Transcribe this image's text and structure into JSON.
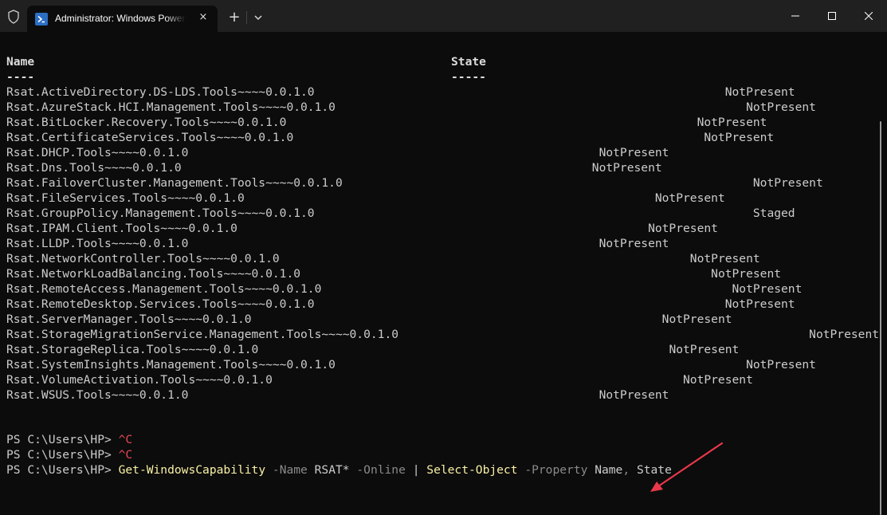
{
  "window": {
    "tab_title": "Administrator: Windows PowerShell",
    "tab_close": "×",
    "new_tab": "+"
  },
  "table": {
    "headers": [
      "Name",
      "State"
    ],
    "underlines": [
      "----",
      "-----"
    ],
    "rows": [
      {
        "name": "Rsat.ActiveDirectory.DS-LDS.Tools~~~~0.0.1.0",
        "state": "NotPresent"
      },
      {
        "name": "Rsat.AzureStack.HCI.Management.Tools~~~~0.0.1.0",
        "state": "NotPresent"
      },
      {
        "name": "Rsat.BitLocker.Recovery.Tools~~~~0.0.1.0",
        "state": "NotPresent"
      },
      {
        "name": "Rsat.CertificateServices.Tools~~~~0.0.1.0",
        "state": "NotPresent"
      },
      {
        "name": "Rsat.DHCP.Tools~~~~0.0.1.0",
        "state": "NotPresent"
      },
      {
        "name": "Rsat.Dns.Tools~~~~0.0.1.0",
        "state": "NotPresent"
      },
      {
        "name": "Rsat.FailoverCluster.Management.Tools~~~~0.0.1.0",
        "state": "NotPresent"
      },
      {
        "name": "Rsat.FileServices.Tools~~~~0.0.1.0",
        "state": "NotPresent"
      },
      {
        "name": "Rsat.GroupPolicy.Management.Tools~~~~0.0.1.0",
        "state": "Staged"
      },
      {
        "name": "Rsat.IPAM.Client.Tools~~~~0.0.1.0",
        "state": "NotPresent"
      },
      {
        "name": "Rsat.LLDP.Tools~~~~0.0.1.0",
        "state": "NotPresent"
      },
      {
        "name": "Rsat.NetworkController.Tools~~~~0.0.1.0",
        "state": "NotPresent"
      },
      {
        "name": "Rsat.NetworkLoadBalancing.Tools~~~~0.0.1.0",
        "state": "NotPresent"
      },
      {
        "name": "Rsat.RemoteAccess.Management.Tools~~~~0.0.1.0",
        "state": "NotPresent"
      },
      {
        "name": "Rsat.RemoteDesktop.Services.Tools~~~~0.0.1.0",
        "state": "NotPresent"
      },
      {
        "name": "Rsat.ServerManager.Tools~~~~0.0.1.0",
        "state": "NotPresent"
      },
      {
        "name": "Rsat.StorageMigrationService.Management.Tools~~~~0.0.1.0",
        "state": "NotPresent"
      },
      {
        "name": "Rsat.StorageReplica.Tools~~~~0.0.1.0",
        "state": "NotPresent"
      },
      {
        "name": "Rsat.SystemInsights.Management.Tools~~~~0.0.1.0",
        "state": "NotPresent"
      },
      {
        "name": "Rsat.VolumeActivation.Tools~~~~0.0.1.0",
        "state": "NotPresent"
      },
      {
        "name": "Rsat.WSUS.Tools~~~~0.0.1.0",
        "state": "NotPresent"
      }
    ]
  },
  "prompts": [
    {
      "prompt": "PS C:\\Users\\HP> ",
      "ctrl": "^C"
    },
    {
      "prompt": "PS C:\\Users\\HP> ",
      "ctrl": "^C"
    }
  ],
  "command": {
    "prompt": "PS C:\\Users\\HP> ",
    "cmdlet": "Get-WindowsCapability",
    "param_name": "-Name",
    "name_value": "RSAT*",
    "param_online": "-Online",
    "pipe": "|",
    "cmdlet2": "Select-Object",
    "param_property": "-Property",
    "property1": "Name",
    "comma": ",",
    "property2": "State"
  },
  "colors": {
    "background": "#0c0c0c",
    "titlebar": "#202020",
    "text": "#cccccc",
    "cmdlet": "#f9f1a5",
    "parameter": "#8a8a8a",
    "ctrl_c": "#e74856",
    "annotation_arrow": "#e8384a"
  },
  "icons": {
    "tab_icon": "powershell-icon",
    "shield": "shield-icon",
    "minimize": "minimize-icon",
    "maximize": "maximize-icon",
    "close": "close-icon",
    "dropdown": "chevron-down-icon",
    "annotation": "arrow-annotation"
  }
}
